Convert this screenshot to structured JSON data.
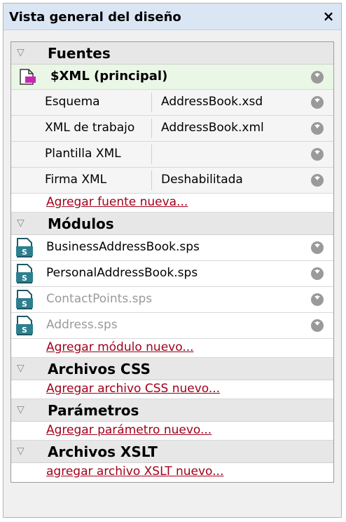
{
  "panel": {
    "title": "Vista general del diseño",
    "close_symbol": "×"
  },
  "sources": {
    "header": "Fuentes",
    "main_source": "$XML (principal)",
    "properties": [
      {
        "label": "Esquema",
        "value": "AddressBook.xsd"
      },
      {
        "label": "XML de trabajo",
        "value": "AddressBook.xml"
      },
      {
        "label": "Plantilla XML",
        "value": ""
      },
      {
        "label": "Firma XML",
        "value": "Deshabilitada"
      }
    ],
    "add_link": "Agregar fuente nueva..."
  },
  "modules": {
    "header": "Módulos",
    "items": [
      {
        "name": "BusinessAddressBook.sps",
        "dimmed": false
      },
      {
        "name": "PersonalAddressBook.sps",
        "dimmed": false
      },
      {
        "name": "ContactPoints.sps",
        "dimmed": true
      },
      {
        "name": "Address.sps",
        "dimmed": true
      }
    ],
    "add_link": "Agregar módulo nuevo..."
  },
  "css_files": {
    "header": "Archivos CSS",
    "add_link": "Agregar archivo CSS nuevo..."
  },
  "parameters": {
    "header": "Parámetros",
    "add_link": "Agregar parámetro nuevo..."
  },
  "xslt_files": {
    "header": "Archivos XSLT",
    "add_link": "agregar archivo XSLT nuevo..."
  },
  "icons": {
    "collapse": "triangle-down-icon",
    "menu": "circle-arrow-down-icon",
    "xml_source": "xml-document-icon",
    "module": "sps-module-icon"
  },
  "colors": {
    "link": "#a1001b",
    "title_bar": "#dbe6f5",
    "main_row": "#eaf6e6",
    "dimmed_text": "#9a9a9a"
  }
}
